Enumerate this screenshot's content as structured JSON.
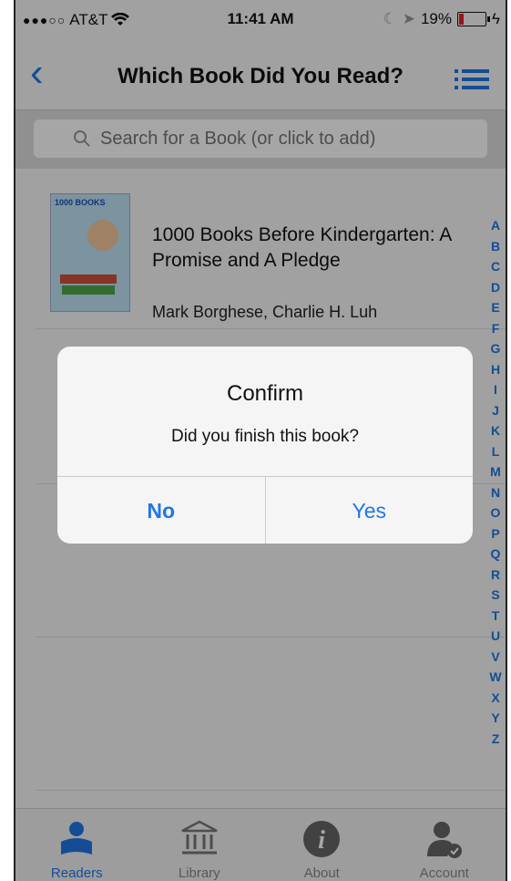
{
  "status_bar": {
    "carrier": "AT&T",
    "time": "11:41 AM",
    "battery": "19%"
  },
  "nav": {
    "title": "Which Book Did You Read?"
  },
  "search": {
    "placeholder": "Search for a Book (or click to add)"
  },
  "book": {
    "title": "1000 Books Before Kindergarten: A Promise and A Pledge",
    "author": "Mark Borghese, Charlie H. Luh",
    "cover_text": "1000 BOOKS"
  },
  "index_letters": [
    "A",
    "B",
    "C",
    "D",
    "E",
    "F",
    "G",
    "H",
    "I",
    "J",
    "K",
    "L",
    "M",
    "N",
    "O",
    "P",
    "Q",
    "R",
    "S",
    "T",
    "U",
    "V",
    "W",
    "X",
    "Y",
    "Z"
  ],
  "dialog": {
    "title": "Confirm",
    "message": "Did you finish this book?",
    "no_label": "No",
    "yes_label": "Yes"
  },
  "tabs": [
    {
      "label": "Readers",
      "icon": "reader-icon"
    },
    {
      "label": "Library",
      "icon": "library-icon"
    },
    {
      "label": "About",
      "icon": "info-icon"
    },
    {
      "label": "Account",
      "icon": "account-icon"
    }
  ],
  "colors": {
    "accent": "#1f77e5",
    "battery_low": "#e8202a"
  }
}
